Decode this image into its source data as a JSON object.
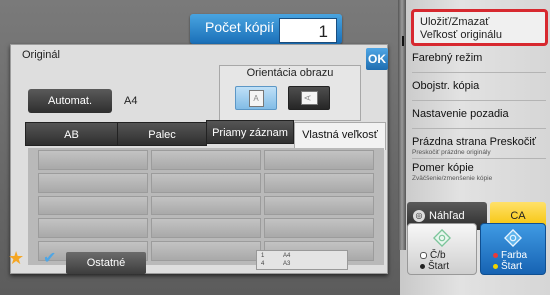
{
  "header": {
    "copies_label": "Počet kópií",
    "copies_value": "1"
  },
  "dialog": {
    "title": "Originál",
    "ok_label": "OK",
    "orientation_label": "Orientácia obrazu",
    "orientation_portrait_glyph": "A",
    "orientation_landscape_glyph": "A",
    "auto_button": "Automat.",
    "size_value": "A4",
    "tabs": [
      {
        "label": "AB",
        "selected": false
      },
      {
        "label": "Palec",
        "selected": false
      },
      {
        "label": "Priamy záznam",
        "selected": false
      },
      {
        "label": "Vlastná veľkosť",
        "selected": true
      }
    ]
  },
  "right_panel": {
    "save_item": {
      "line1": "Uložiť/Zmazať",
      "line2": "Veľkosť originálu"
    },
    "items": [
      {
        "label": "Farebný režim",
        "sub": ""
      },
      {
        "label": "Obojstr. kópia",
        "sub": ""
      },
      {
        "label": "Nastavenie pozadia",
        "sub": ""
      },
      {
        "label": "Prázdna strana Preskočiť",
        "sub": "Preskočiť prázdne originály"
      },
      {
        "label": "Pomer kópie",
        "sub": "Zväčšenie/zmenšenie kópie"
      }
    ],
    "preview_label": "Náhľad",
    "ca_label": "CA",
    "bw_start": {
      "line1": "Č/b",
      "line2": "Štart"
    },
    "color_start": {
      "line1": "Farba",
      "line2": "Štart"
    }
  },
  "bottom_bar": {
    "other_label": "Ostatné",
    "status": {
      "row1_left": "1",
      "row1_right": "A4",
      "row2_left": "4",
      "row2_right": "A3"
    }
  },
  "colors": {
    "accent_blue": "#1e6db0",
    "highlight_red": "#d7282f",
    "ca_yellow": "#f5c100"
  }
}
